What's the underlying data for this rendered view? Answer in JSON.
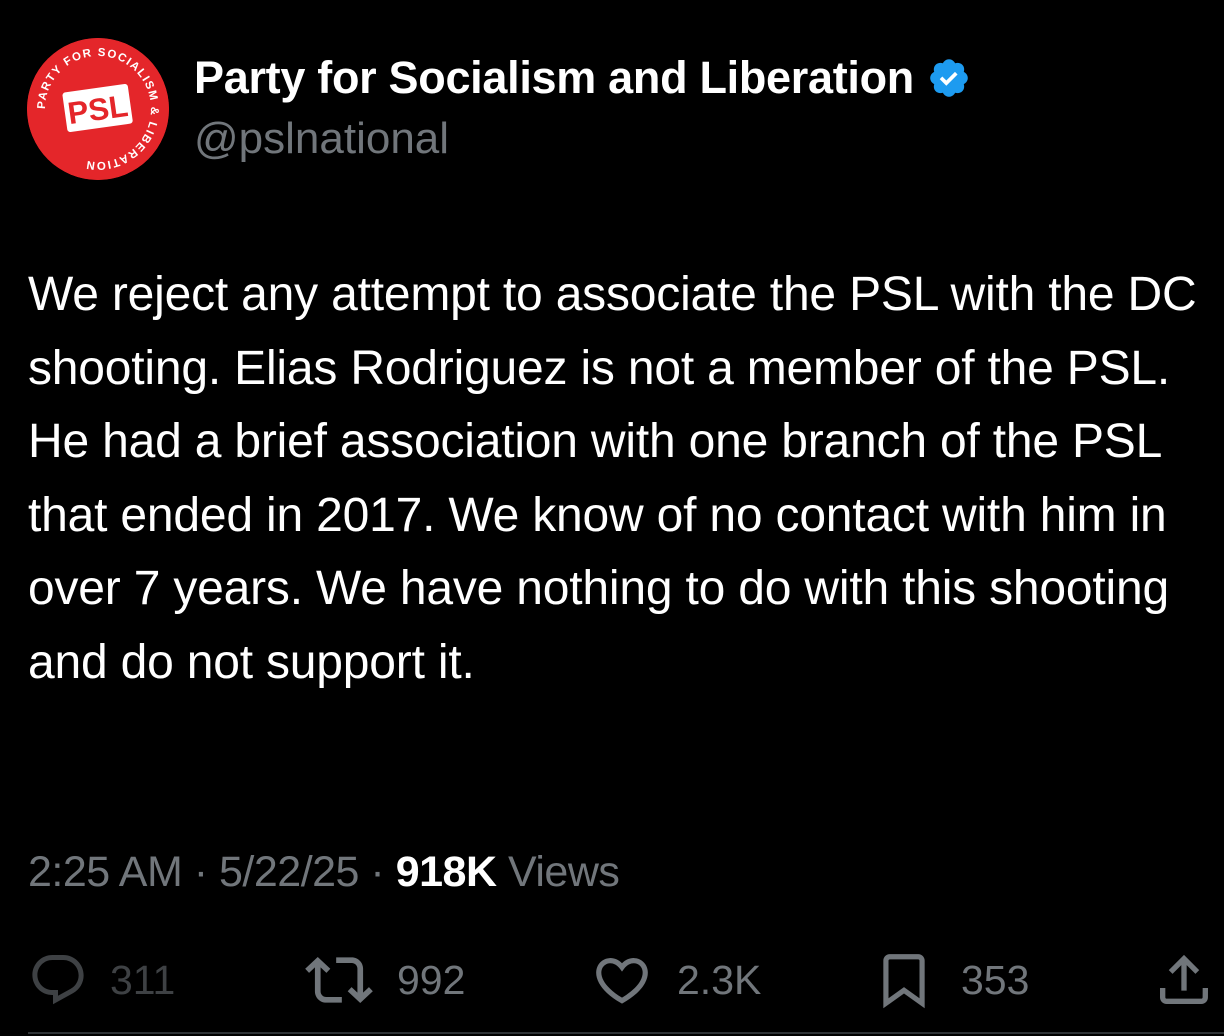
{
  "author": {
    "display_name": "Party for Socialism and Liberation",
    "handle": "@pslnational",
    "verified": true,
    "avatar": {
      "icon": "psl-logo",
      "logo_text": "PSL",
      "ring_text": "PARTY FOR SOCIALISM & LIBERATION",
      "color": "#e4262a"
    }
  },
  "tweet": {
    "text": "We reject any attempt to associate the PSL with the DC shooting. Elias Rodriguez is not a member of the PSL. He had a brief association with one branch of the PSL that ended in 2017. We know of no contact with him in over 7 years. We have nothing to do with this shooting and do not support it.",
    "time": "2:25 AM",
    "date": "5/22/25",
    "separator": "·",
    "views_count": "918K",
    "views_label": "Views"
  },
  "actions": {
    "replies": "311",
    "reposts": "992",
    "likes": "2.3K",
    "bookmarks": "353"
  },
  "colors": {
    "background": "#000000",
    "text": "#ffffff",
    "secondary": "#71767b",
    "verified_badge": "#1d9bf0"
  }
}
